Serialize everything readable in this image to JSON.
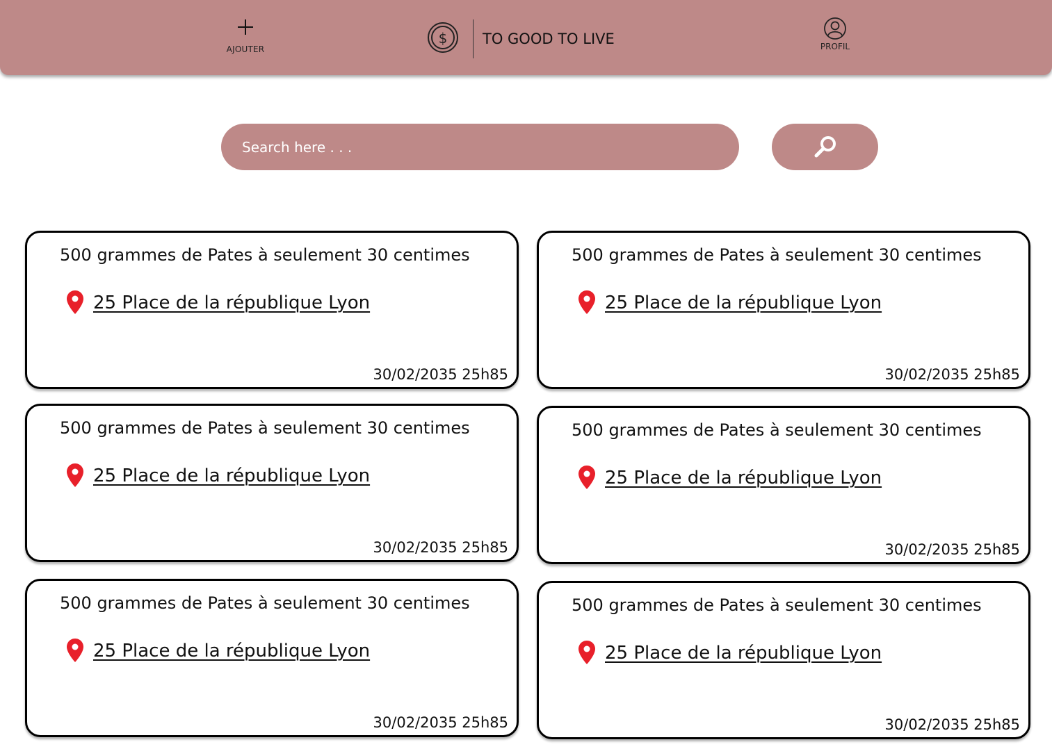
{
  "header": {
    "add_label": "AJOUTER",
    "app_title": "TO GOOD TO LIVE",
    "profile_label": "PROFIL"
  },
  "search": {
    "placeholder": "Search here . . ."
  },
  "colors": {
    "accent": "#be8988",
    "pin": "#e8202a"
  },
  "icons": [
    "plus-icon",
    "dollar-coin-icon",
    "user-circle-icon",
    "search-icon",
    "location-pin-icon"
  ],
  "cards": [
    {
      "title": "500 grammes de Pates à seulement 30 centimes",
      "address": "25 Place de la république Lyon",
      "date": "30/02/2035 25h85"
    },
    {
      "title": "500 grammes de Pates à seulement 30 centimes",
      "address": "25 Place de la république Lyon",
      "date": "30/02/2035 25h85"
    },
    {
      "title": "500 grammes de Pates à seulement 30 centimes",
      "address": "25 Place de la république Lyon",
      "date": "30/02/2035 25h85"
    },
    {
      "title": "500 grammes de Pates à seulement 30 centimes",
      "address": "25 Place de la république Lyon",
      "date": "30/02/2035 25h85"
    },
    {
      "title": "500 grammes de Pates à seulement 30 centimes",
      "address": "25 Place de la république Lyon",
      "date": "30/02/2035 25h85"
    },
    {
      "title": "500 grammes de Pates à seulement 30 centimes",
      "address": "25 Place de la république Lyon",
      "date": "30/02/2035 25h85"
    }
  ]
}
